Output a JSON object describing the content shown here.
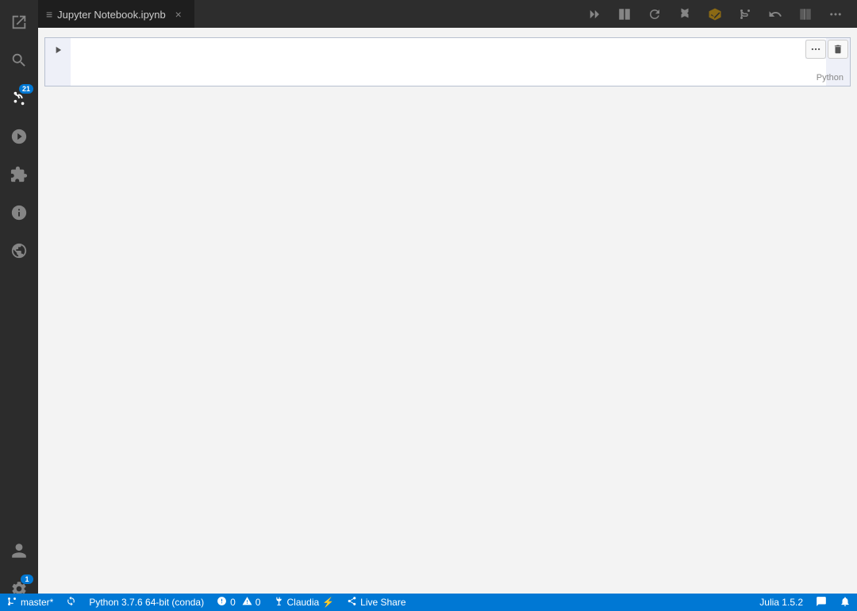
{
  "tab": {
    "icon": "≡",
    "title": "Jupyter Notebook.ipynb",
    "close_label": "×"
  },
  "toolbar": {
    "run_all": "▶▶",
    "interrupt": "⬛",
    "restart": "↺",
    "variables": "📊",
    "source": "⬦",
    "branch": "⑂",
    "undo": "↩",
    "split": "⬛",
    "more": "···"
  },
  "cell": {
    "run_icon": "▶",
    "bracket": "[ ]",
    "language": "Python",
    "more_icon": "···",
    "delete_icon": "🗑"
  },
  "status_bar": {
    "branch_icon": "⎇",
    "branch_name": "master*",
    "sync_icon": "↻",
    "python_label": "Python 3.7.6 64-bit (conda)",
    "errors_icon": "⊗",
    "errors_count": "0",
    "warnings_icon": "⚠",
    "warnings_count": "0",
    "user_icon": "🔌",
    "user_name": "Claudia",
    "user_suffix": "⚡",
    "liveshare_icon": "↗",
    "liveshare_label": "Live Share",
    "kernel_label": "Julia 1.5.2",
    "feedback_icon": "💬",
    "bell_icon": "🔔",
    "badge_count": "21"
  }
}
